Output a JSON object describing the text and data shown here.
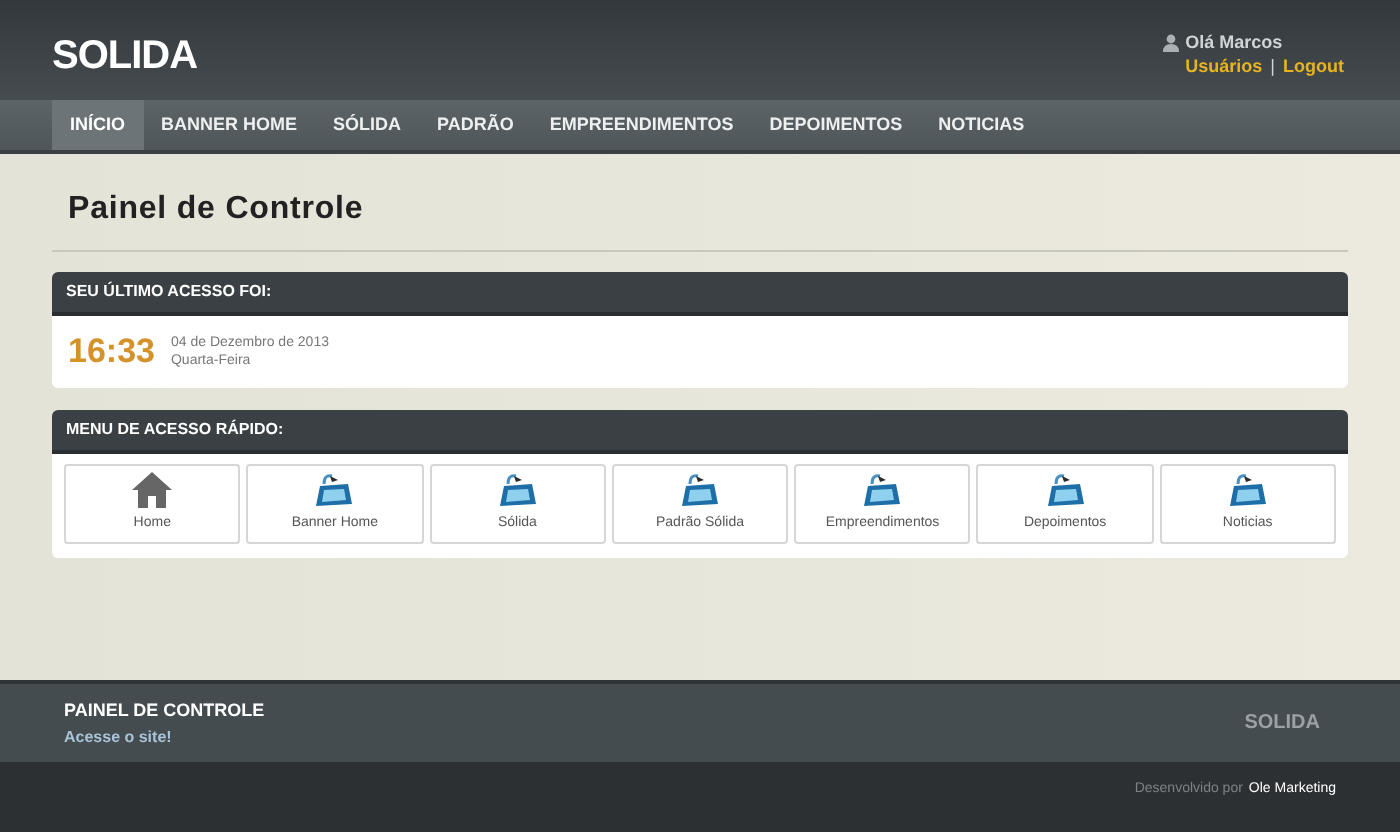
{
  "header": {
    "logo": "SOLIDA",
    "greeting": "Olá Marcos",
    "links": [
      "Usuários",
      "Logout"
    ],
    "separator": "|"
  },
  "nav": [
    {
      "label": "INÍCIO",
      "selected": true
    },
    {
      "label": "BANNER HOME",
      "selected": false
    },
    {
      "label": "SÓLIDA",
      "selected": false
    },
    {
      "label": "PADRÃO",
      "selected": false
    },
    {
      "label": "EMPREENDIMENTOS",
      "selected": false
    },
    {
      "label": "DEPOIMENTOS",
      "selected": false
    },
    {
      "label": "NOTICIAS",
      "selected": false
    }
  ],
  "page_title": "Painel de Controle",
  "last_access": {
    "title": "SEU ÚLTIMO ACESSO FOI:",
    "time": "16:33",
    "date": "04 de Dezembro de 2013",
    "weekday": "Quarta-Feira"
  },
  "quick_menu": {
    "title": "MENU DE ACESSO RÁPIDO:",
    "items": [
      {
        "label": "Home",
        "kind": "home"
      },
      {
        "label": "Banner Home",
        "kind": "module"
      },
      {
        "label": "Sólida",
        "kind": "module"
      },
      {
        "label": "Padrão Sólida",
        "kind": "module"
      },
      {
        "label": "Empreendimentos",
        "kind": "module"
      },
      {
        "label": "Depoimentos",
        "kind": "module"
      },
      {
        "label": "Noticias",
        "kind": "module"
      }
    ]
  },
  "footer": {
    "title": "PAINEL DE CONTROLE",
    "link": "Acesse o site!",
    "brand": "SOLIDA",
    "credit": "Desenvolvido por",
    "credit_link": "Ole Marketing"
  }
}
